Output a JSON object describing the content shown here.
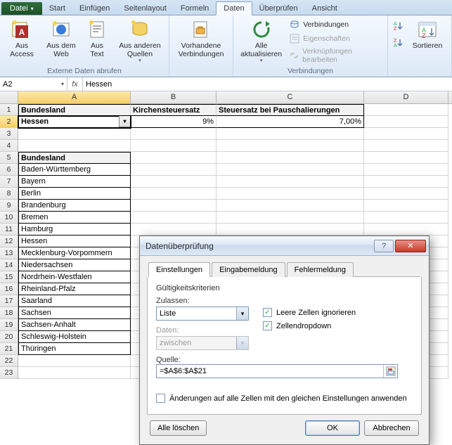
{
  "ribbon": {
    "file_label": "Datei",
    "tabs": [
      "Start",
      "Einfügen",
      "Seitenlayout",
      "Formeln",
      "Daten",
      "Überprüfen",
      "Ansicht"
    ],
    "active_tab": "Daten",
    "group_ext_label": "Externe Daten abrufen",
    "btn_access": "Aus Access",
    "btn_web": "Aus dem Web",
    "btn_text": "Aus Text",
    "btn_other": "Aus anderen Quellen",
    "btn_existing": "Vorhandene Verbindungen",
    "btn_refresh": "Alle aktualisieren",
    "group_conn_label": "Verbindungen",
    "link_conn": "Verbindungen",
    "link_props": "Eigenschaften",
    "link_edit": "Verknüpfungen bearbeiten",
    "btn_sort": "Sortieren"
  },
  "formula_bar": {
    "name": "A2",
    "fx": "fx",
    "value": "Hessen"
  },
  "cols": [
    "A",
    "B",
    "C",
    "D"
  ],
  "rows": [
    "1",
    "2",
    "3",
    "4",
    "5",
    "6",
    "7",
    "8",
    "9",
    "10",
    "11",
    "12",
    "13",
    "14",
    "15",
    "16",
    "17",
    "18",
    "19",
    "20",
    "21",
    "22",
    "23"
  ],
  "sheet": {
    "r1": {
      "a": "Bundesland",
      "b": "Kirchensteuersatz",
      "c": "Steuersatz bei Pauschalierungen"
    },
    "r2": {
      "a": "Hessen",
      "b": "9%",
      "c": "7,00%"
    },
    "r5": {
      "a": "Bundesland"
    },
    "list": [
      "Baden-Württemberg",
      "Bayern",
      "Berlin",
      "Brandenburg",
      "Bremen",
      "Hamburg",
      "Hessen",
      "Mecklenburg-Vorpommern",
      "Niedersachsen",
      "Nordrhein-Westfalen",
      "Rheinland-Pfalz",
      "Saarland",
      "Sachsen",
      "Sachsen-Anhalt",
      "Schleswig-Holstein",
      "Thüringen"
    ]
  },
  "dialog": {
    "title": "Datenüberprüfung",
    "tabs": {
      "settings": "Einstellungen",
      "input": "Eingabemeldung",
      "error": "Fehlermeldung"
    },
    "criteria_label": "Gültigkeitskriterien",
    "allow_label": "Zulassen:",
    "allow_value": "Liste",
    "data_label": "Daten:",
    "data_value": "zwischen",
    "ignore_blank": "Leere Zellen ignorieren",
    "dropdown": "Zellendropdown",
    "source_label": "Quelle:",
    "source_value": "=$A$6:$A$21",
    "apply_all": "Änderungen auf alle Zellen mit den gleichen Einstellungen anwenden",
    "clear_all": "Alle löschen",
    "ok": "OK",
    "cancel": "Abbrechen"
  }
}
